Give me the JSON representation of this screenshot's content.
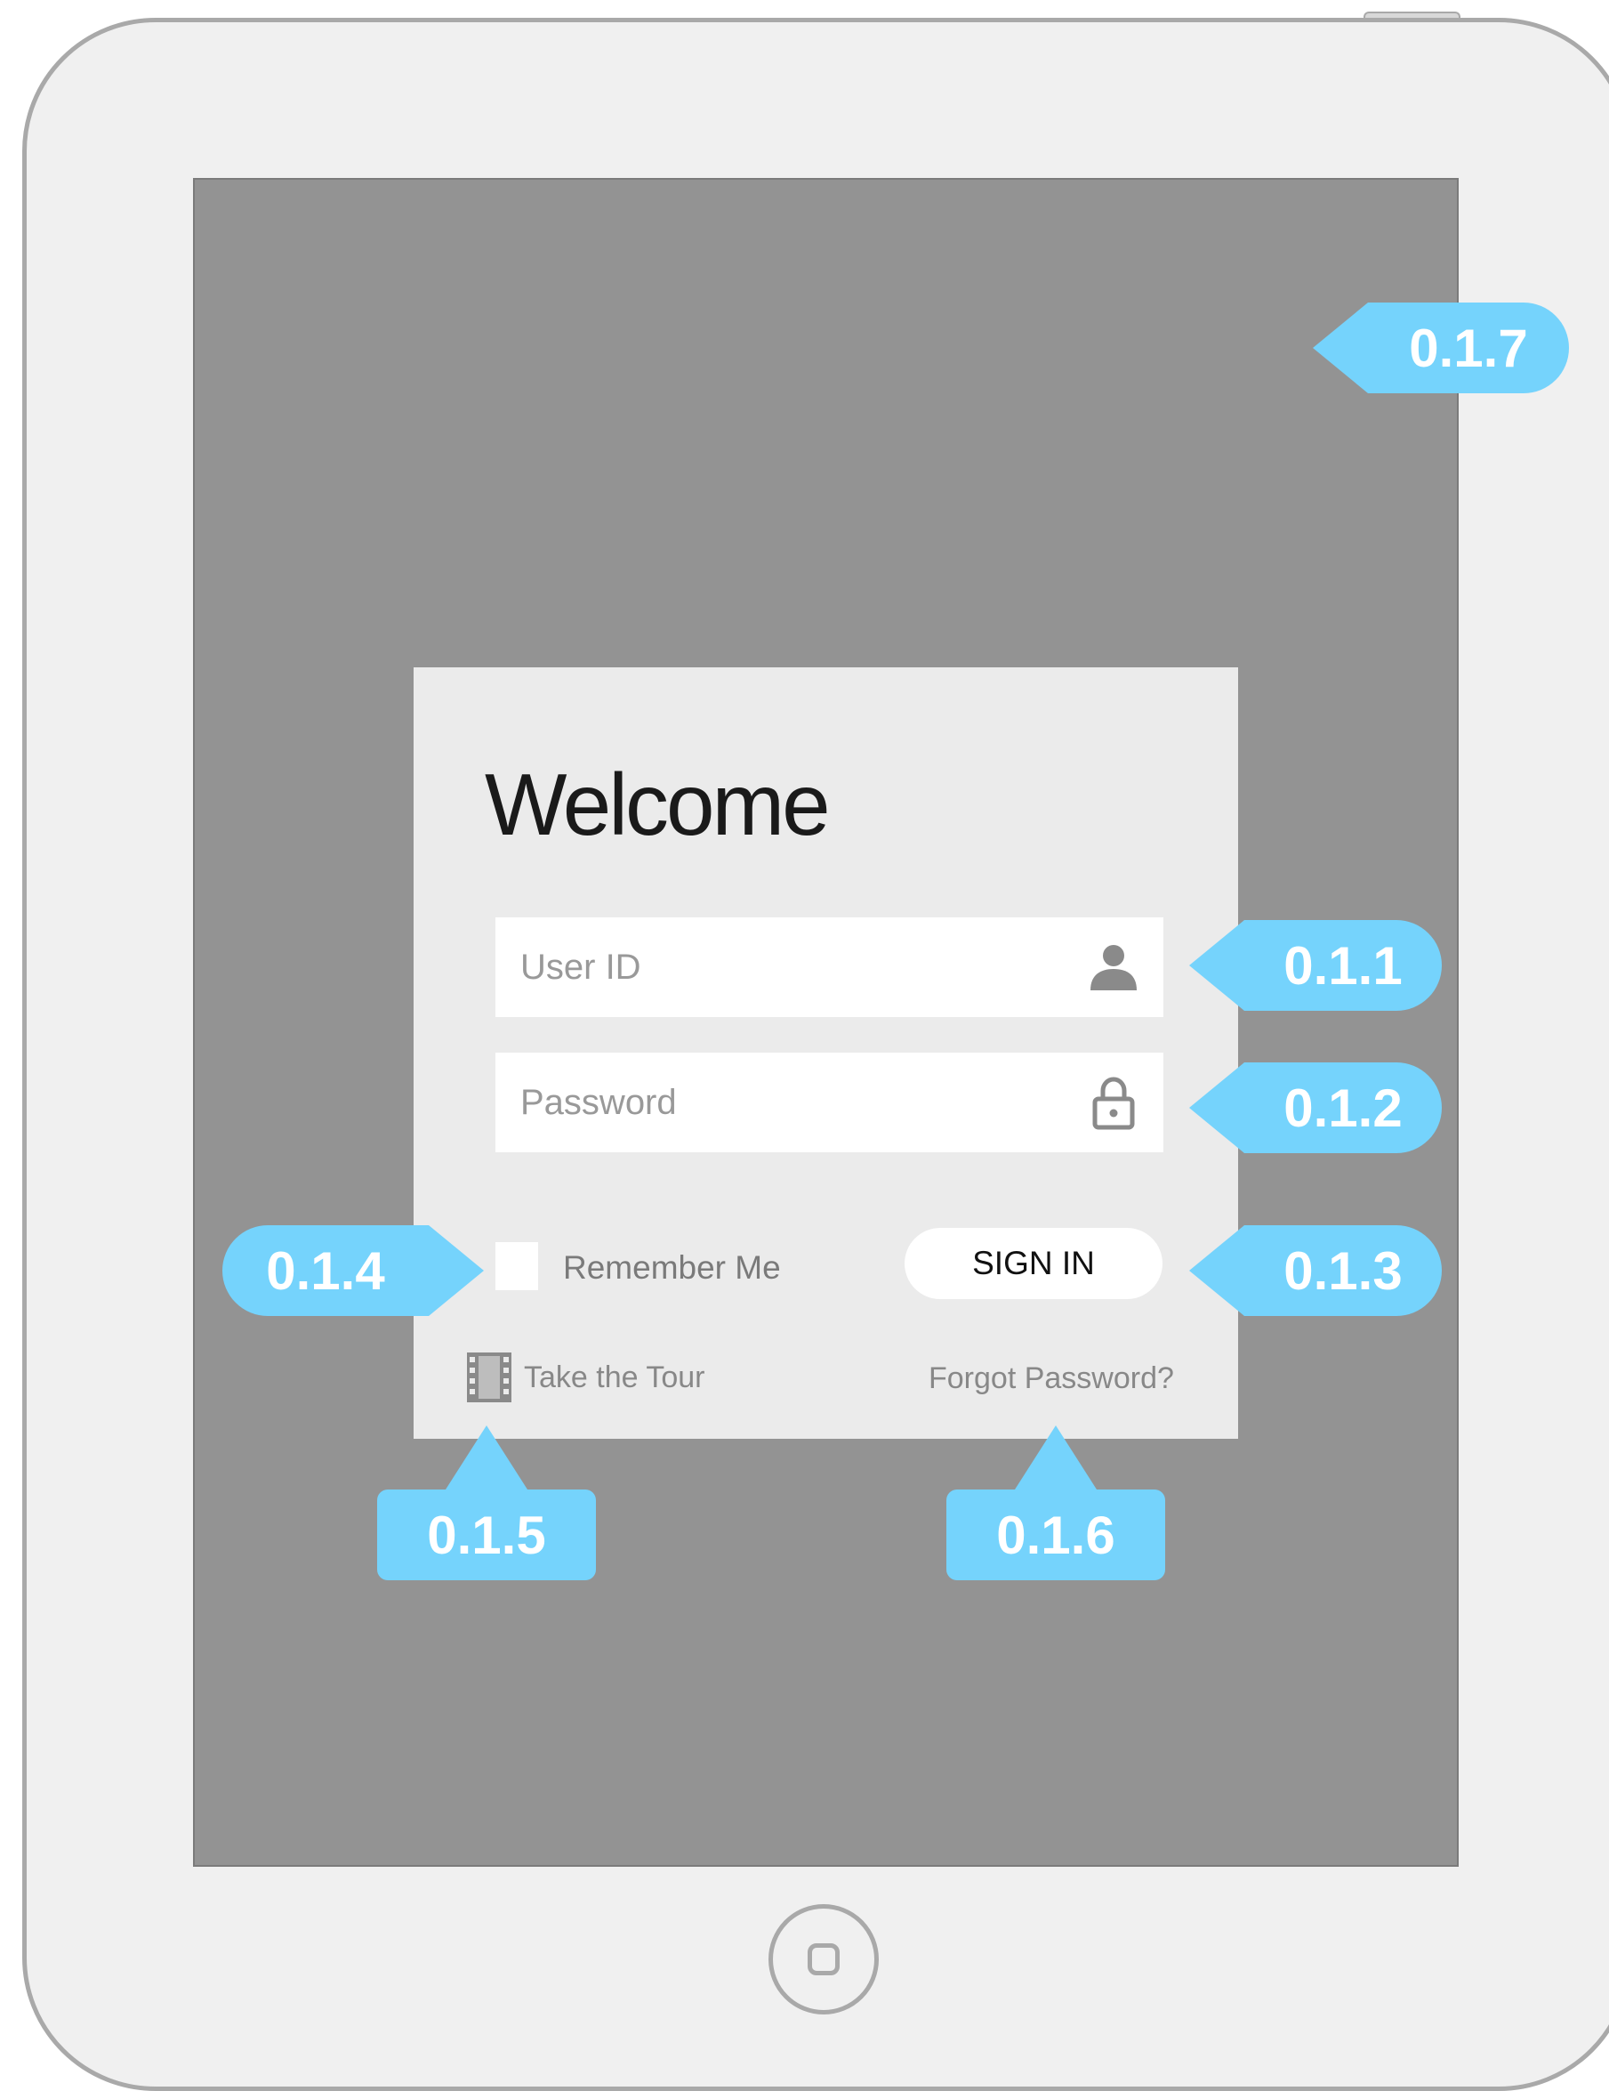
{
  "login": {
    "title": "Welcome",
    "user_id_placeholder": "User ID",
    "user_id_value": "",
    "password_placeholder": "Password",
    "password_value": "",
    "remember_label": "Remember Me",
    "remember_checked": false,
    "signin_label": "SIGN IN",
    "tour_label": "Take the Tour",
    "forgot_label": "Forgot Password?"
  },
  "icons": {
    "user_field": "user-icon",
    "password_field": "lock-icon",
    "tour": "film-icon",
    "home": "home-button-icon"
  },
  "annotations": {
    "user_id": "0.1.1",
    "password": "0.1.2",
    "signin": "0.1.3",
    "remember": "0.1.4",
    "tour": "0.1.5",
    "forgot": "0.1.6",
    "screen": "0.1.7"
  },
  "colors": {
    "device_body": "#f0f0f0",
    "screen": "#939393",
    "card": "#ebebeb",
    "callout": "#75d3fc"
  }
}
